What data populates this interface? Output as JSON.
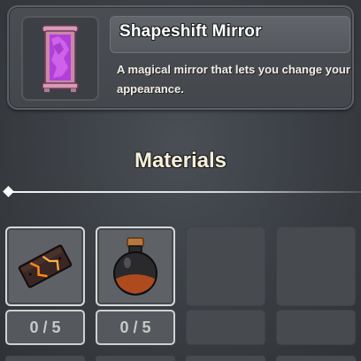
{
  "item": {
    "name": "Shapeshift Mirror",
    "description": "A magical mirror that lets you change your appearance.",
    "icon": "magic-mirror-icon",
    "icon_color": "#c04be0",
    "frame_color": "#d89ab8"
  },
  "materials": {
    "title": "Materials",
    "slots": [
      {
        "icon": "cracked-lava-plank-icon",
        "count": "0 / 5",
        "filled": true
      },
      {
        "icon": "dark-potion-flask-icon",
        "count": "0 / 5",
        "filled": true
      },
      {
        "icon": "",
        "count": "",
        "filled": false
      },
      {
        "icon": "",
        "count": "",
        "filled": false
      }
    ]
  }
}
